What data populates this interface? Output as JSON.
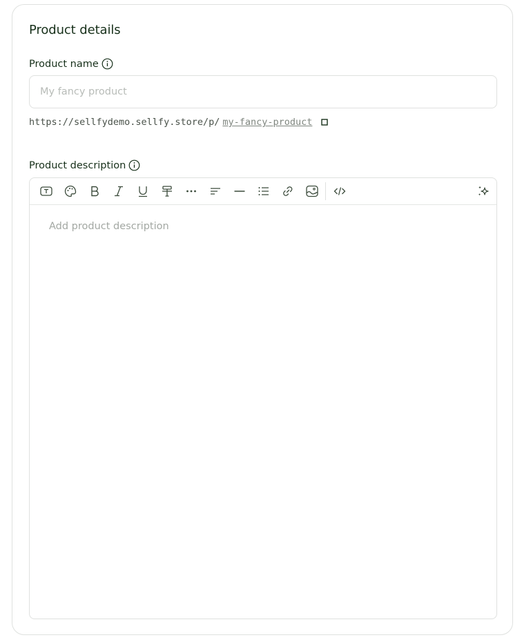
{
  "section": {
    "title": "Product details"
  },
  "product_name": {
    "label": "Product name",
    "placeholder": "My fancy product",
    "value": "",
    "url_prefix": "https://sellfydemo.sellfy.store/p/",
    "url_slug": "my-fancy-product"
  },
  "product_description": {
    "label": "Product description",
    "placeholder": "Add product description"
  },
  "toolbar": {
    "buttons": [
      "text-style-icon",
      "palette-icon",
      "bold-icon",
      "italic-icon",
      "underline-icon",
      "strikethrough-icon",
      "more-icon",
      "align-icon",
      "horizontal-rule-icon",
      "list-icon",
      "link-icon",
      "image-icon",
      "code-icon",
      "ai-sparkle-icon"
    ]
  },
  "colors": {
    "text": "#17301a",
    "border": "#dfe1df",
    "placeholder": "#a3a8a3",
    "icon": "#3a4a3a"
  }
}
